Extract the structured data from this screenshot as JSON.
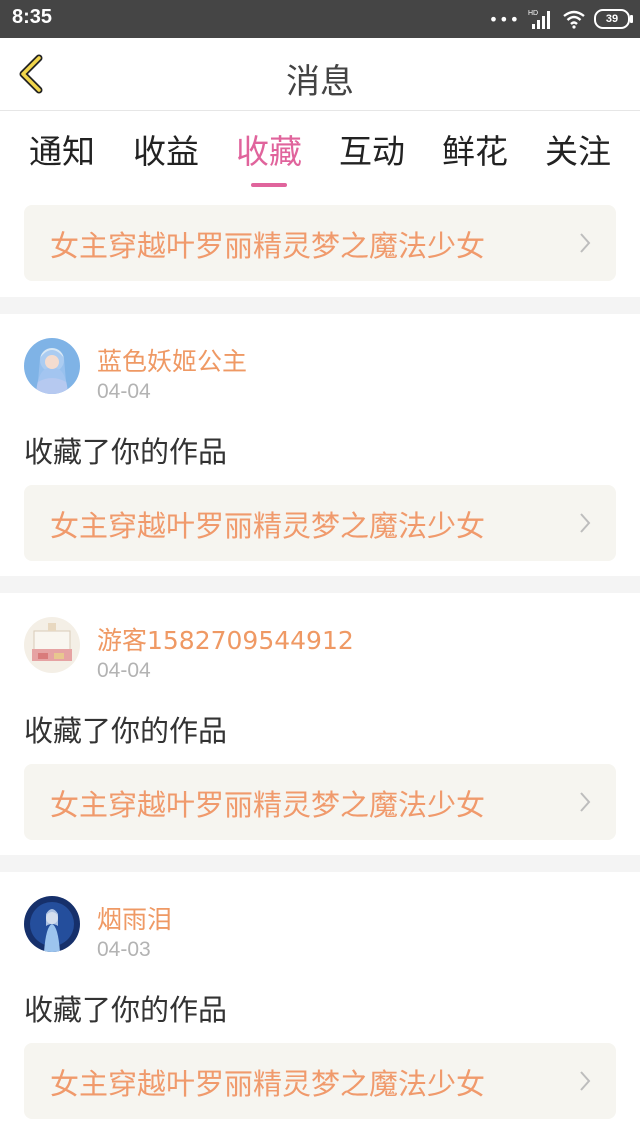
{
  "status": {
    "time": "8:35",
    "network": "HD",
    "battery": "39"
  },
  "header": {
    "title": "消息",
    "back_icon": "chevron-left-icon"
  },
  "tabs": [
    {
      "label": "通知"
    },
    {
      "label": "收益"
    },
    {
      "label": "收藏",
      "active": true
    },
    {
      "label": "互动"
    },
    {
      "label": "鲜花"
    },
    {
      "label": "关注"
    }
  ],
  "top_work": {
    "title": "女主穿越叶罗丽精灵梦之魔法少女"
  },
  "messages": [
    {
      "name": "蓝色妖姬公主",
      "date": "04-04",
      "action": "收藏了你的作品",
      "work": "女主穿越叶罗丽精灵梦之魔法少女"
    },
    {
      "name": "游客1582709544912",
      "date": "04-04",
      "action": "收藏了你的作品",
      "work": "女主穿越叶罗丽精灵梦之魔法少女"
    },
    {
      "name": "烟雨泪",
      "date": "04-03",
      "action": "收藏了你的作品",
      "work": "女主穿越叶罗丽精灵梦之魔法少女"
    }
  ],
  "colors": {
    "accent": "#e0649c",
    "name": "#ef9964",
    "work_title": "#f09a6c",
    "card_bg": "#f6f5f0"
  }
}
